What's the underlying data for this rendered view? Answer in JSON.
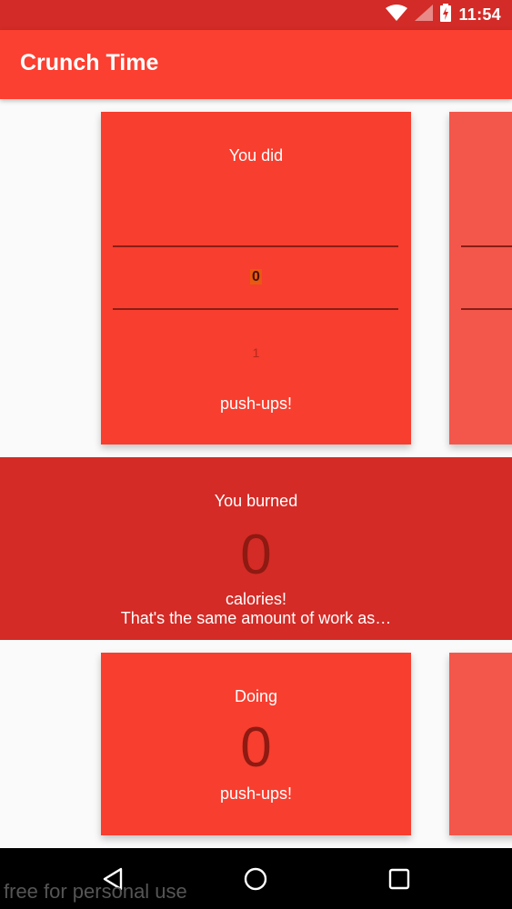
{
  "status_bar": {
    "time": "11:54",
    "icons": [
      "wifi-icon",
      "signal-icon",
      "battery-charging-icon"
    ]
  },
  "app_bar": {
    "title": "Crunch Time"
  },
  "pushup_card": {
    "title": "You did",
    "picker_selected": "0",
    "picker_next": "1",
    "unit": "push-ups!"
  },
  "burn_section": {
    "title": "You burned",
    "calories": "0",
    "unit": "calories!",
    "comparison": "That's the same amount of work as…"
  },
  "equivalent_card": {
    "title": "Doing",
    "count": "0",
    "unit": "push-ups!"
  },
  "nav_bar": {
    "buttons": [
      "back-icon",
      "home-icon",
      "recents-icon"
    ]
  },
  "watermark": "free for personal use",
  "colors": {
    "primary": "#fb3f30",
    "primary_dark": "#d32b27",
    "card": "#f73e2f",
    "number": "#8e1a12"
  }
}
